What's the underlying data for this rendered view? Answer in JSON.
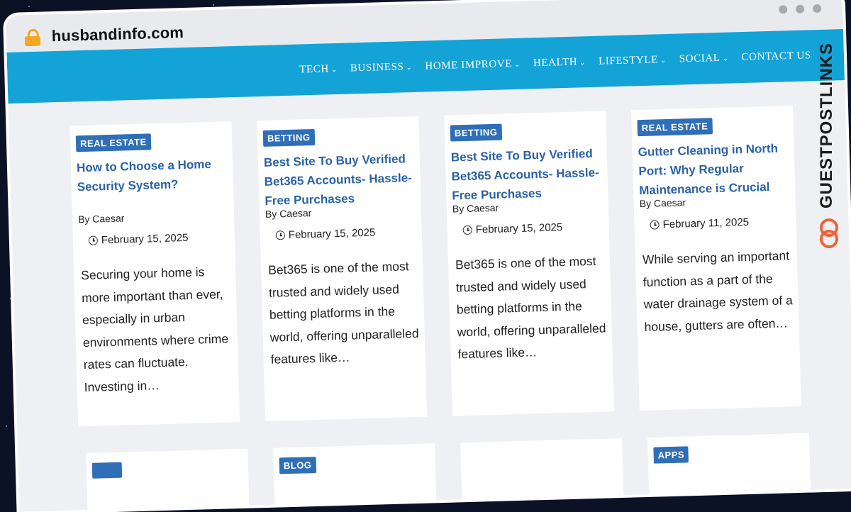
{
  "browser": {
    "url": "husbandinfo.com"
  },
  "nav": {
    "items": [
      {
        "label": "TECH",
        "has_dropdown": true
      },
      {
        "label": "BUSINESS",
        "has_dropdown": true
      },
      {
        "label": "HOME IMPROVE",
        "has_dropdown": true
      },
      {
        "label": "HEALTH",
        "has_dropdown": true
      },
      {
        "label": "LIFESTYLE",
        "has_dropdown": true
      },
      {
        "label": "SOCIAL",
        "has_dropdown": true
      },
      {
        "label": "CONTACT US",
        "has_dropdown": false
      }
    ]
  },
  "posts": [
    {
      "category": "REAL ESTATE",
      "title": "How to Choose a Home Security System?",
      "author": "By Caesar",
      "date": "February 15, 2025",
      "excerpt": "Securing your home is more important than ever, especially in urban environments where crime rates can fluctuate. Investing in…"
    },
    {
      "category": "BETTING",
      "title": "Best Site To Buy Verified Bet365 Accounts- Hassle-Free Purchases",
      "author": "By Caesar",
      "date": "February 15, 2025",
      "excerpt": "Bet365 is one of the most trusted and widely used betting platforms in the world, offering unparalleled features like…"
    },
    {
      "category": "BETTING",
      "title": "Best Site To Buy Verified Bet365 Accounts- Hassle-Free Purchases",
      "author": "By Caesar",
      "date": "February 15, 2025",
      "excerpt": "Bet365 is one of the most trusted and widely used betting platforms in the world, offering unparalleled features like…"
    },
    {
      "category": "REAL ESTATE",
      "title": "Gutter Cleaning in North Port: Why Regular Maintenance is Crucial",
      "author": "By Caesar",
      "date": "February 11, 2025",
      "excerpt": "While serving an important function as a part of the water drainage system of a house, gutters are often…"
    }
  ],
  "next_row": {
    "categories": [
      "",
      "BLOG",
      "",
      "APPS"
    ]
  },
  "brand": {
    "name": "GUESTPOSTLINKS",
    "accent_color": "#e8653a"
  },
  "colors": {
    "nav_bg": "#14a3d7",
    "badge_bg": "#2f6fb8",
    "title_color": "#2a62a6"
  }
}
